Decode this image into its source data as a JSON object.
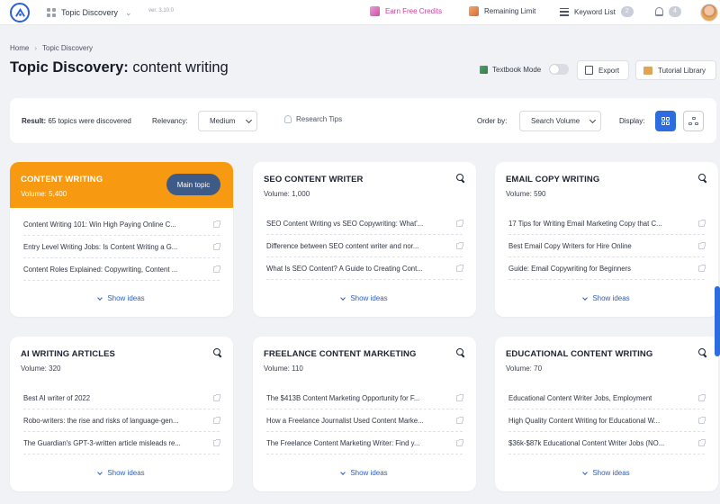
{
  "topbar": {
    "app_name": "Topic Discovery",
    "version": "ver. 3.10.0",
    "earn_credits": "Earn Free Credits",
    "remaining_limit": "Remaining Limit",
    "keyword_list": "Keyword List",
    "keyword_count": "2",
    "notification_count": "4"
  },
  "breadcrumb": {
    "home": "Home",
    "current": "Topic Discovery"
  },
  "page": {
    "title_prefix": "Topic Discovery:",
    "title_query": "content writing",
    "textbook_mode": "Textbook Mode",
    "export": "Export",
    "tutorial": "Tutorial Library"
  },
  "filters": {
    "result_label": "Result:",
    "result_text": "65 topics were discovered",
    "relevancy_label": "Relevancy:",
    "relevancy_value": "Medium",
    "tips": "Research Tips",
    "order_label": "Order by:",
    "order_value": "Search Volume",
    "display_label": "Display:"
  },
  "colors": {
    "accent": "#2d6be0",
    "main_topic": "#f79a12",
    "pill": "#3e5a86"
  },
  "cards": [
    {
      "title": "CONTENT WRITING",
      "volume": "Volume: 5,400",
      "main_label": "Main topic",
      "show": "Show ideas",
      "ideas": [
        "Content Writing 101: Win High Paying Online C...",
        "Entry Level Writing Jobs: Is Content Writing a G...",
        "Content Roles Explained: Copywriting, Content ..."
      ]
    },
    {
      "title": "SEO CONTENT WRITER",
      "volume": "Volume: 1,000",
      "show": "Show ideas",
      "ideas": [
        "SEO Content Writing vs SEO Copywriting: What'...",
        "Difference between SEO content writer and nor...",
        "What Is SEO Content? A Guide to Creating Cont..."
      ]
    },
    {
      "title": "EMAIL COPY WRITING",
      "volume": "Volume: 590",
      "show": "Show ideas",
      "ideas": [
        "17 Tips for Writing Email Marketing Copy that C...",
        "Best Email Copy Writers for Hire Online",
        "Guide: Email Copywriting for Beginners"
      ]
    },
    {
      "title": "AI WRITING ARTICLES",
      "volume": "Volume: 320",
      "show": "Show ideas",
      "ideas": [
        "Best AI writer of 2022",
        "Robo-writers: the rise and risks of language-gen...",
        "The Guardian's GPT-3-written article misleads re..."
      ]
    },
    {
      "title": "FREELANCE CONTENT MARKETING",
      "volume": "Volume: 110",
      "show": "Show ideas",
      "ideas": [
        "The $413B Content Marketing Opportunity for F...",
        "How a Freelance Journalist Used Content Marke...",
        "The Freelance Content Marketing Writer: Find y..."
      ]
    },
    {
      "title": "EDUCATIONAL CONTENT WRITING",
      "volume": "Volume: 70",
      "show": "Show ideas",
      "ideas": [
        "Educational Content Writer Jobs, Employment",
        "High Quality Content Writing for Educational W...",
        "$36k-$87k Educational Content Writer Jobs (NO..."
      ]
    }
  ]
}
